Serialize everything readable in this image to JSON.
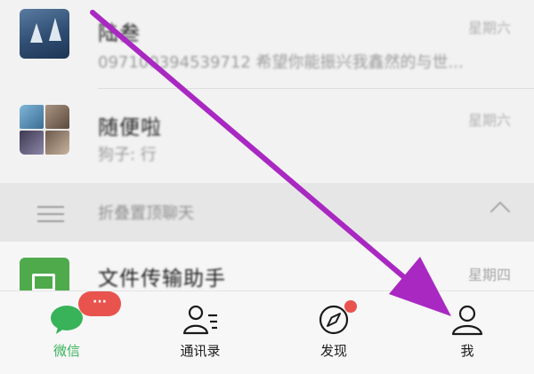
{
  "chats": [
    {
      "name": "陆叁",
      "preview": "0971003945397​12 希望你能振兴我鑫然的与世...",
      "time": "星期六"
    },
    {
      "name": "随便啦",
      "preview": "狗子: 行",
      "time": "星期六"
    }
  ],
  "fold": {
    "label": "折叠置顶聊天"
  },
  "file_transfer": {
    "name": "文件传输助手",
    "time": "星期四"
  },
  "tabs": [
    {
      "label": "微信",
      "badge": "···"
    },
    {
      "label": "通讯录"
    },
    {
      "label": "发现"
    },
    {
      "label": "我"
    }
  ],
  "colors": {
    "accent_green": "#38b35a",
    "badge_red": "#e9534e",
    "annotation_arrow": "#a928c2"
  },
  "icons": [
    "chat-bubble-icon",
    "contacts-icon",
    "compass-icon",
    "person-icon",
    "fold-list-icon",
    "chevron-up-icon",
    "file-folder-icon",
    "arrow-annotation"
  ]
}
